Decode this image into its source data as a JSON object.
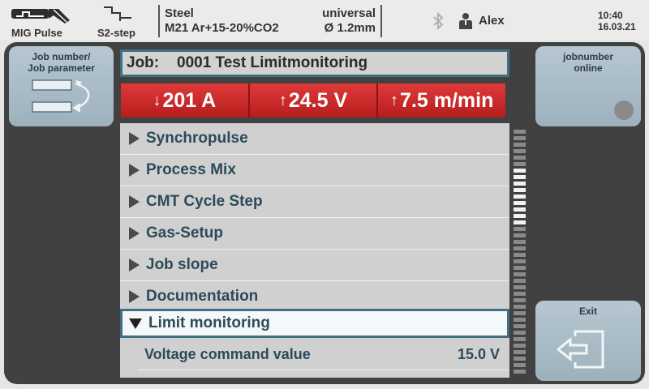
{
  "status": {
    "mode": {
      "label": "MIG Pulse",
      "icon": "mig-pulse-icon"
    },
    "step": {
      "label": "S2-step",
      "icon": "s2-step-icon"
    },
    "material": "Steel",
    "gas": "M21 Ar+15-20%CO2",
    "characteristic": "universal",
    "wire": "Ø 1.2mm",
    "bluetooth_icon": "bluetooth-icon",
    "user_icon": "user-icon",
    "user": "Alex",
    "time": "10:40",
    "date": "16.03.21"
  },
  "left_button": {
    "label_1": "Job number/",
    "label_2": "Job parameter",
    "icon": "job-parameter-swap-icon"
  },
  "right_button": {
    "label_1": "jobnumber",
    "label_2": "online",
    "icon": "indicator-icon"
  },
  "exit_button": {
    "label": "Exit",
    "icon": "exit-icon"
  },
  "job": {
    "label": "Job:",
    "name": "0001 Test Limitmonitoring"
  },
  "params": [
    {
      "arrow": "↓",
      "value": "201 A"
    },
    {
      "arrow": "↑",
      "value": "24.5 V"
    },
    {
      "arrow": "↑",
      "value": "7.5 m/min"
    }
  ],
  "menu": {
    "items": [
      {
        "label": "Synchropulse"
      },
      {
        "label": "Process Mix"
      },
      {
        "label": "CMT Cycle Step"
      },
      {
        "label": "Gas-Setup"
      },
      {
        "label": "Job slope"
      },
      {
        "label": "Documentation"
      },
      {
        "label": "Limit monitoring",
        "expanded": true
      }
    ],
    "subitems": [
      {
        "label": "Voltage command value",
        "value": "15.0 V"
      }
    ]
  },
  "scrollbar": {
    "segments": 38,
    "thumb_start": 6,
    "thumb_end": 14
  },
  "colors": {
    "param_red": "#c82a2a",
    "accent": "#3f6e85",
    "button": "#a9bcc7"
  }
}
